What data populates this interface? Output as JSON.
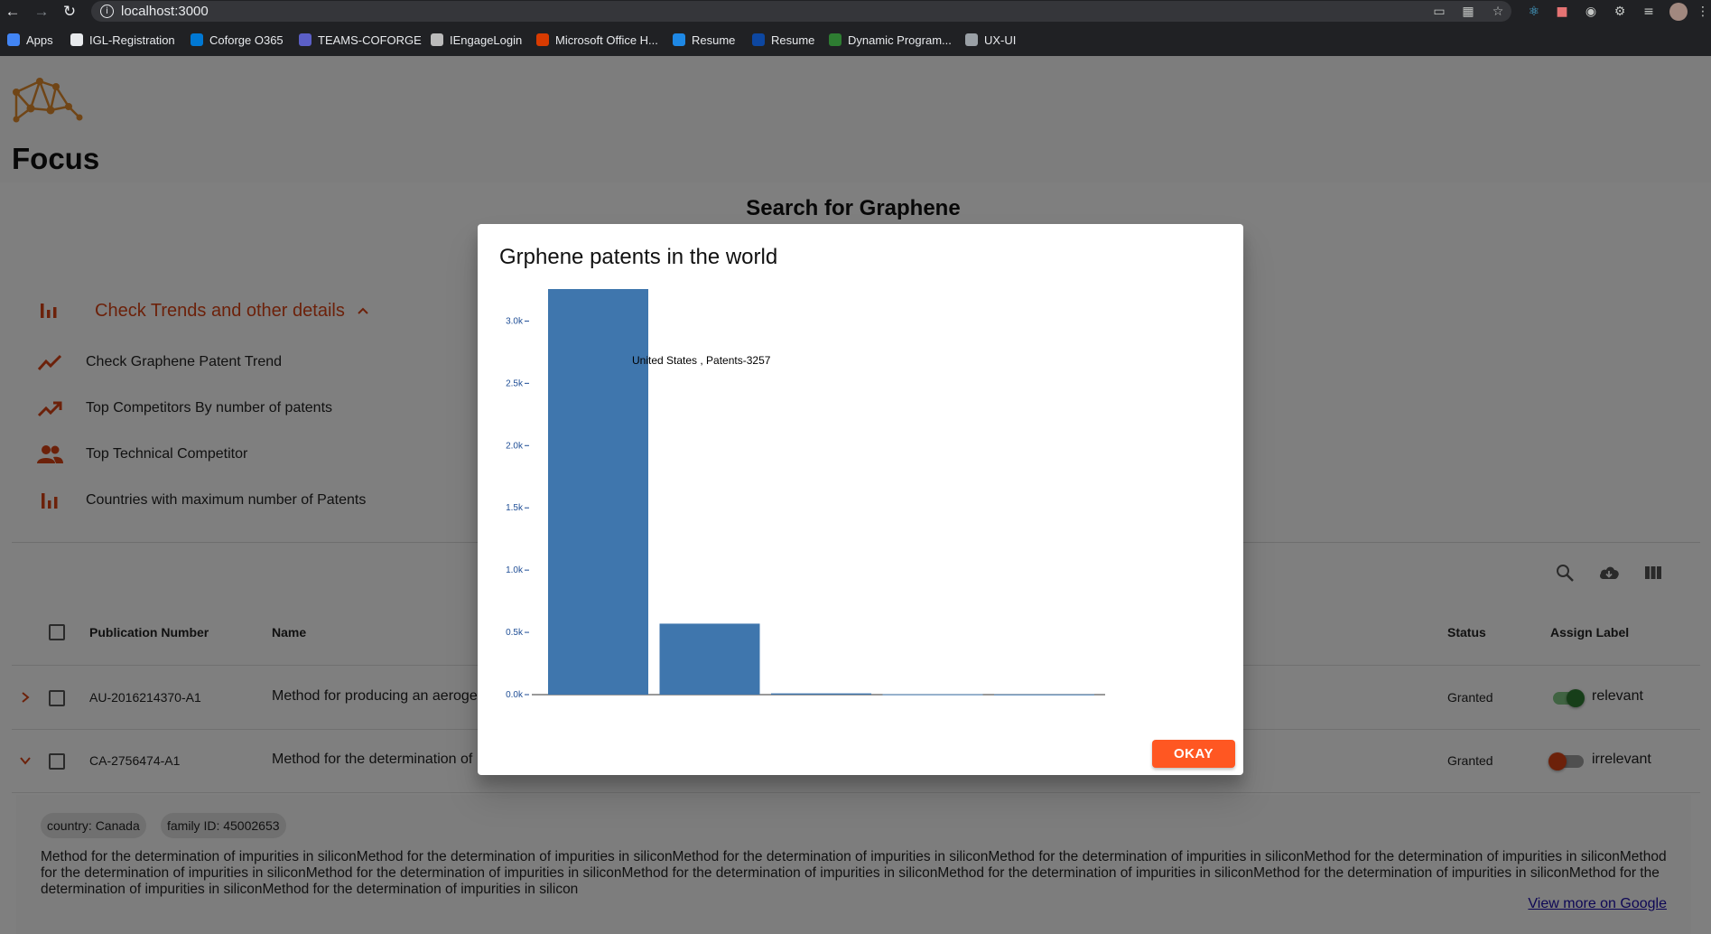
{
  "browser": {
    "url": "localhost:3000",
    "bookmarks": [
      {
        "label": "Apps",
        "color": "#4285f4"
      },
      {
        "label": "IGL-Registration",
        "color": "#e8eaed"
      },
      {
        "label": "Coforge O365",
        "color": "#0078d4"
      },
      {
        "label": "TEAMS-COFORGE",
        "color": "#5b5fc7"
      },
      {
        "label": "IEngageLogin",
        "color": "#bbbbbb"
      },
      {
        "label": "Microsoft Office H...",
        "color": "#d83b01"
      },
      {
        "label": "Resume",
        "color": "#1e88e5"
      },
      {
        "label": "Resume",
        "color": "#0d47a1"
      },
      {
        "label": "Dynamic Program...",
        "color": "#2e7d32"
      },
      {
        "label": "UX-UI",
        "color": "#9aa0a6"
      }
    ]
  },
  "app": {
    "brand": "Focus",
    "search_title": "Search for Graphene",
    "trends": {
      "label": "Check Trends and other details",
      "items": [
        {
          "label": "Check Graphene Patent Trend",
          "icon": "trending-icon"
        },
        {
          "label": "Top Competitors By number of patents",
          "icon": "trending-up-icon"
        },
        {
          "label": "Top Technical Competitor",
          "icon": "people-icon"
        },
        {
          "label": "Countries with maximum number of Patents",
          "icon": "bar-chart-icon"
        }
      ]
    },
    "table": {
      "headers": {
        "publication": "Publication Number",
        "name": "Name",
        "status": "Status",
        "label": "Assign Label"
      },
      "rows": [
        {
          "pub": "AU-2016214370-A1",
          "name": "Method for producing an aeroge",
          "status": "Granted",
          "label": "relevant",
          "on": true
        },
        {
          "pub": "CA-2756474-A1",
          "name": "Method for the determination of",
          "status": "Granted",
          "label": "irrelevant",
          "on": false
        }
      ],
      "detail": {
        "country": "country: Canada",
        "family": "family ID: 45002653",
        "description": "Method for the determination of impurities in siliconMethod for the determination of impurities in siliconMethod for the determination of impurities in siliconMethod for the determination of impurities in siliconMethod for the determination of impurities in siliconMethod for the determination of impurities in siliconMethod for the determination of impurities in siliconMethod for the determination of impurities in siliconMethod for the determination of impurities in siliconMethod for the determination of impurities in siliconMethod for the determination of impurities in siliconMethod for the determination of impurities in silicon",
        "link": "View more on Google"
      }
    }
  },
  "modal": {
    "title": "Grphene patents in the world",
    "ok_label": "OKAY",
    "tooltip": "United States , Patents-3257"
  },
  "chart_data": {
    "type": "bar",
    "title": "",
    "xlabel": "",
    "ylabel": "",
    "categories": [
      "United States",
      "",
      "",
      "",
      ""
    ],
    "values": [
      3257,
      570,
      10,
      3,
      2
    ],
    "ylim": [
      0,
      3257
    ],
    "yticks": [
      "0.0k",
      "0.5k",
      "1.0k",
      "1.5k",
      "2.0k",
      "2.5k",
      "3.0k"
    ],
    "ytick_values": [
      0,
      500,
      1000,
      1500,
      2000,
      2500,
      3000
    ],
    "color": "#3f76ad"
  }
}
